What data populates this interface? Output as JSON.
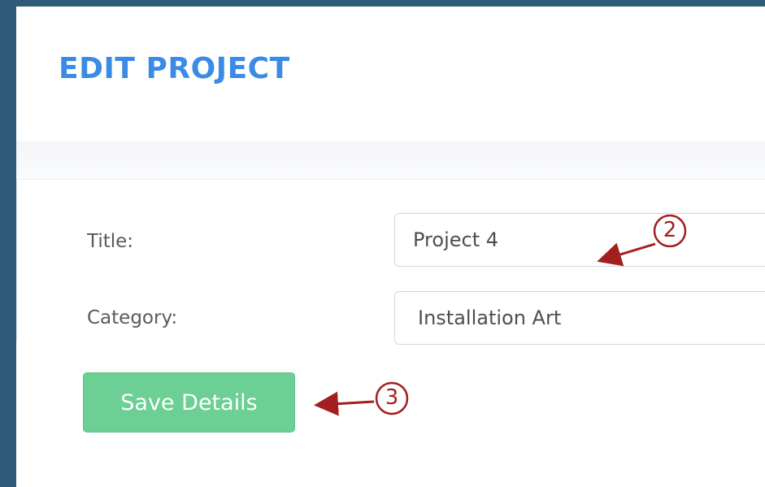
{
  "header": {
    "title": "EDIT PROJECT"
  },
  "form": {
    "title_label": "Title:",
    "title_value": "Project 4",
    "category_label": "Category:",
    "category_value": "Installation Art",
    "save_label": "Save Details"
  },
  "annotations": [
    {
      "number": "2"
    },
    {
      "number": "3"
    }
  ],
  "colors": {
    "background": "#2f5b78",
    "title": "#3b8be6",
    "save_button": "#6ccf93",
    "annotation": "#a31e1e"
  }
}
